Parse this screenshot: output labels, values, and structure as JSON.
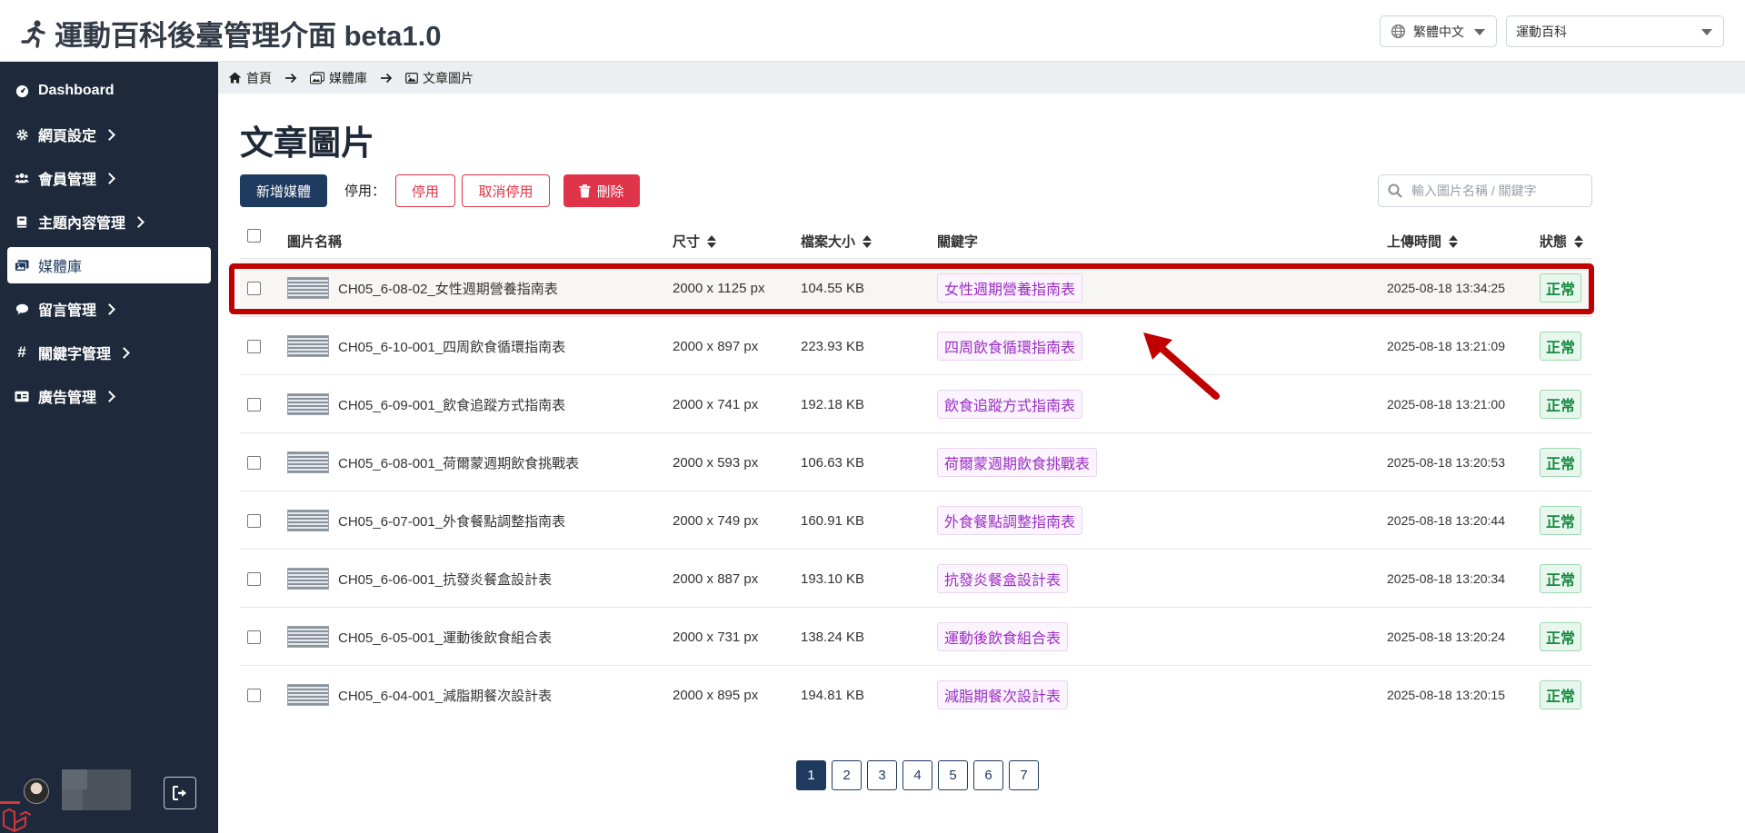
{
  "header": {
    "title": "運動百科後臺管理介面 beta1.0",
    "language": "繁體中文",
    "site": "運動百科"
  },
  "sidebar": {
    "items": [
      {
        "label": "Dashboard",
        "icon": "dashboard-icon",
        "has_children": false,
        "active": false
      },
      {
        "label": "網頁設定",
        "icon": "gear-icon",
        "has_children": true,
        "active": false
      },
      {
        "label": "會員管理",
        "icon": "users-icon",
        "has_children": true,
        "active": false
      },
      {
        "label": "主題內容管理",
        "icon": "book-icon",
        "has_children": true,
        "active": false
      },
      {
        "label": "媒體庫",
        "icon": "images-icon",
        "has_children": false,
        "active": true
      },
      {
        "label": "留言管理",
        "icon": "comment-icon",
        "has_children": true,
        "active": false
      },
      {
        "label": "關鍵字管理",
        "icon": "hashtag-icon",
        "has_children": true,
        "active": false
      },
      {
        "label": "廣告管理",
        "icon": "ad-icon",
        "has_children": true,
        "active": false
      }
    ]
  },
  "breadcrumb": {
    "items": [
      {
        "label": "首頁",
        "icon": "home-icon"
      },
      {
        "label": "媒體庫",
        "icon": "images-icon"
      },
      {
        "label": "文章圖片",
        "icon": "image-icon"
      }
    ]
  },
  "page": {
    "title": "文章圖片",
    "add_label": "新增媒體",
    "disable_prefix": "停用：",
    "disable_label": "停用",
    "enable_label": "取消停用",
    "delete_label": "刪除",
    "search_placeholder": "輸入圖片名稱 / 關鍵字"
  },
  "table": {
    "columns": {
      "name": "圖片名稱",
      "size": "尺寸",
      "filesize": "檔案大小",
      "keyword": "關鍵字",
      "uploaded": "上傳時間",
      "status": "狀態"
    },
    "rows": [
      {
        "name": "CH05_6-08-02_女性週期營養指南表",
        "size": "2000 x 1125 px",
        "filesize": "104.55 KB",
        "keyword": "女性週期營養指南表",
        "uploaded": "2025-08-18 13:34:25",
        "status": "正常",
        "highlighted": true
      },
      {
        "name": "CH05_6-10-001_四周飲食循環指南表",
        "size": "2000 x 897 px",
        "filesize": "223.93 KB",
        "keyword": "四周飲食循環指南表",
        "uploaded": "2025-08-18 13:21:09",
        "status": "正常"
      },
      {
        "name": "CH05_6-09-001_飲食追蹤方式指南表",
        "size": "2000 x 741 px",
        "filesize": "192.18 KB",
        "keyword": "飲食追蹤方式指南表",
        "uploaded": "2025-08-18 13:21:00",
        "status": "正常"
      },
      {
        "name": "CH05_6-08-001_荷爾蒙週期飲食挑戰表",
        "size": "2000 x 593 px",
        "filesize": "106.63 KB",
        "keyword": "荷爾蒙週期飲食挑戰表",
        "uploaded": "2025-08-18 13:20:53",
        "status": "正常"
      },
      {
        "name": "CH05_6-07-001_外食餐點調整指南表",
        "size": "2000 x 749 px",
        "filesize": "160.91 KB",
        "keyword": "外食餐點調整指南表",
        "uploaded": "2025-08-18 13:20:44",
        "status": "正常"
      },
      {
        "name": "CH05_6-06-001_抗發炎餐盒設計表",
        "size": "2000 x 887 px",
        "filesize": "193.10 KB",
        "keyword": "抗發炎餐盒設計表",
        "uploaded": "2025-08-18 13:20:34",
        "status": "正常"
      },
      {
        "name": "CH05_6-05-001_運動後飲食組合表",
        "size": "2000 x 731 px",
        "filesize": "138.24 KB",
        "keyword": "運動後飲食組合表",
        "uploaded": "2025-08-18 13:20:24",
        "status": "正常"
      },
      {
        "name": "CH05_6-04-001_減脂期餐次設計表",
        "size": "2000 x 895 px",
        "filesize": "194.81 KB",
        "keyword": "減脂期餐次設計表",
        "uploaded": "2025-08-18 13:20:15",
        "status": "正常"
      }
    ]
  },
  "pagination": {
    "pages": [
      "1",
      "2",
      "3",
      "4",
      "5",
      "6",
      "7"
    ],
    "current": "1"
  },
  "colors": {
    "primary": "#1e3a5f",
    "sidebar_bg": "#1e2a3b",
    "danger": "#dc3545",
    "keyword_text": "#9b2fc4",
    "status_ok": "#168a3f",
    "annotation": "#c00000"
  }
}
